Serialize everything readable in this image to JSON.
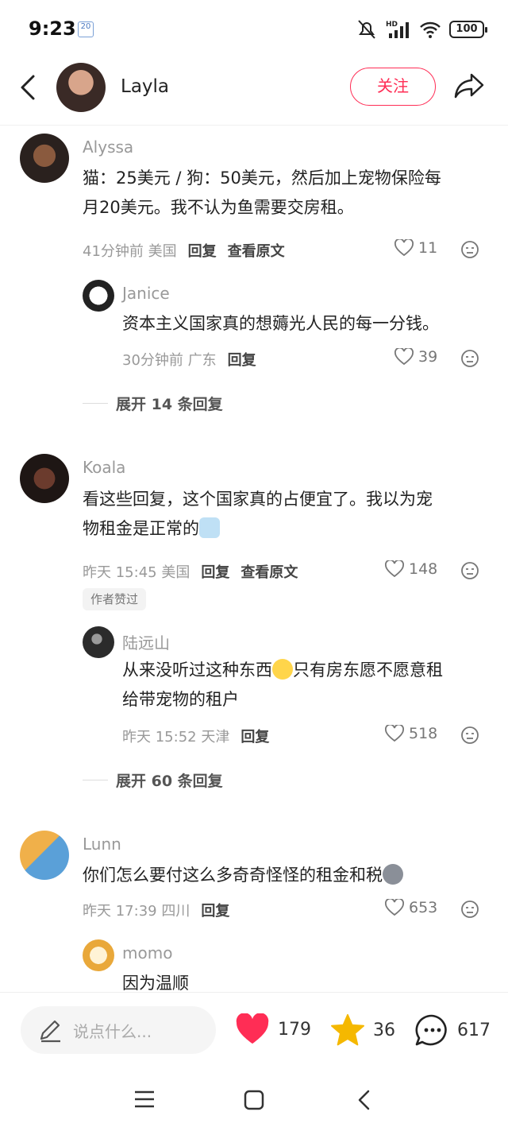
{
  "status": {
    "time": "9:23",
    "date_badge": "20",
    "battery": "100"
  },
  "header": {
    "author": "Layla",
    "follow_label": "关注"
  },
  "comments": [
    {
      "user": "Alyssa",
      "text_line1": "猫：25美元 / 狗：50美元，然后加上宠物保险每",
      "text_line2": "月20美元。我不认为鱼需要交房租。",
      "time": "41分钟前 美国",
      "reply": "回复",
      "view_original": "查看原文",
      "likes": "11",
      "sub": {
        "user": "Janice",
        "text": "资本主义国家真的想薅光人民的每一分钱。",
        "time": "30分钟前 广东",
        "reply": "回复",
        "likes": "39"
      },
      "expand": "展开 14 条回复"
    },
    {
      "user": "Koala",
      "text_line1": "看这些回复，这个国家真的占便宜了。我以为宠",
      "text_line2": "物租金是正常的",
      "time": "昨天 15:45 美国",
      "reply": "回复",
      "view_original": "查看原文",
      "likes": "148",
      "tag": "作者赞过",
      "sub": {
        "user": "陆远山",
        "text_line1": "从来没听过这种东西",
        "text_line1b": "只有房东愿不愿意租",
        "text_line2": "给带宠物的租户",
        "time": "昨天 15:52 天津",
        "reply": "回复",
        "likes": "518"
      },
      "expand": "展开 60 条回复"
    },
    {
      "user": "Lunn",
      "text": "你们怎么要付这么多奇奇怪怪的租金和税",
      "time": "昨天 17:39 四川",
      "reply": "回复",
      "likes": "653",
      "sub": {
        "user": "momo",
        "text": "因为温顺"
      }
    }
  ],
  "bottom": {
    "placeholder": "说点什么...",
    "likes": "179",
    "stars": "36",
    "comments": "617"
  },
  "colors": {
    "accent": "#ff2d55",
    "star": "#f5b800"
  }
}
